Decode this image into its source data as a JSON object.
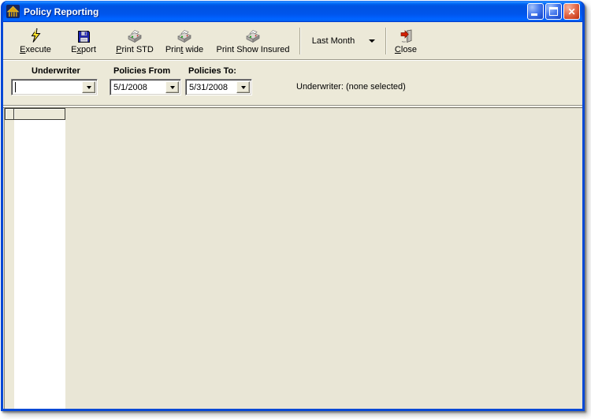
{
  "window": {
    "title": "Policy Reporting",
    "controls": {
      "minimize": "minimize",
      "maximize": "maximize",
      "close": "close"
    }
  },
  "toolbar": {
    "buttons": [
      {
        "id": "execute",
        "icon": "lightning-icon",
        "pre": "",
        "key": "E",
        "post": "xecute"
      },
      {
        "id": "export",
        "icon": "save-floppy-icon",
        "pre": "E",
        "key": "x",
        "post": "port"
      },
      {
        "id": "print-std",
        "icon": "printer-icon",
        "pre": "",
        "key": "P",
        "post": "rint STD"
      },
      {
        "id": "print-wide",
        "icon": "printer-icon",
        "pre": "Prin",
        "key": "t",
        "post": " wide"
      },
      {
        "id": "print-show-insured",
        "icon": "printer-icon",
        "pre": "Print Show Insured",
        "key": "",
        "post": ""
      }
    ],
    "last_month": {
      "label": "Last Month"
    },
    "close_button": {
      "icon": "exit-door-icon",
      "pre": "",
      "key": "C",
      "post": "lose"
    }
  },
  "filterbar": {
    "underwriter": {
      "label": "Underwriter",
      "value": ""
    },
    "policies_from": {
      "label": "Policies From",
      "value": "5/1/2008"
    },
    "policies_to": {
      "label": "Policies To:",
      "value": "5/31/2008"
    },
    "status": "Underwriter: (none selected)"
  },
  "grid": {
    "corner_header": "",
    "column_header": ""
  },
  "colors": {
    "titlebar_blue": "#0054e3",
    "window_border_blue": "#0849d6",
    "client_beige": "#ece9d8",
    "grid_background": "#e9e6d6",
    "data_column_white": "#ffffff",
    "close_button_red": "#cf4524",
    "lightning_yellow": "#ffe32c"
  }
}
